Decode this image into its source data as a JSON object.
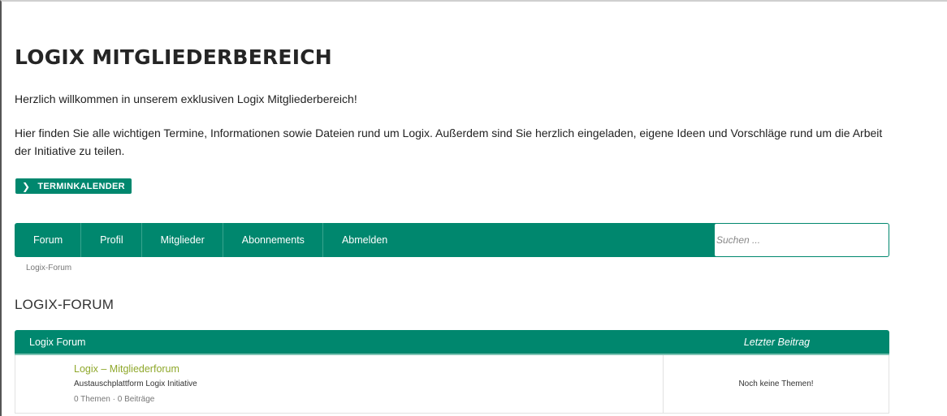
{
  "page": {
    "title": "LOGIX MITGLIEDERBEREICH",
    "welcome": "Herzlich willkommen in unserem exklusiven Logix Mitgliederbereich!",
    "intro": "Hier finden Sie alle wichtigen Termine, Informationen sowie Dateien rund um Logix. Außerdem sind Sie herzlich eingeladen, eigene Ideen und Vorschläge rund um die Arbeit der Initiative zu teilen.",
    "calendar_button": "TERMINKALENDER",
    "calendar_icon": "chevron-right-icon"
  },
  "nav": {
    "items": [
      {
        "label": "Forum"
      },
      {
        "label": "Profil"
      },
      {
        "label": "Mitglieder"
      },
      {
        "label": "Abonnements"
      },
      {
        "label": "Abmelden"
      }
    ],
    "search_placeholder": "Suchen ..."
  },
  "breadcrumb": "Logix-Forum",
  "forum": {
    "heading": "LOGIX-FORUM",
    "table_header": {
      "forum": "Logix Forum",
      "last_post": "Letzter Beitrag"
    },
    "rows": [
      {
        "title": "Logix – Mitgliederforum",
        "description": "Austauschplattform Logix Initiative",
        "stats": "0 Themen · 0 Beiträge",
        "last_post": "Noch keine Themen!"
      }
    ]
  },
  "colors": {
    "accent": "#00876e",
    "forum_link": "#8fa82b"
  }
}
